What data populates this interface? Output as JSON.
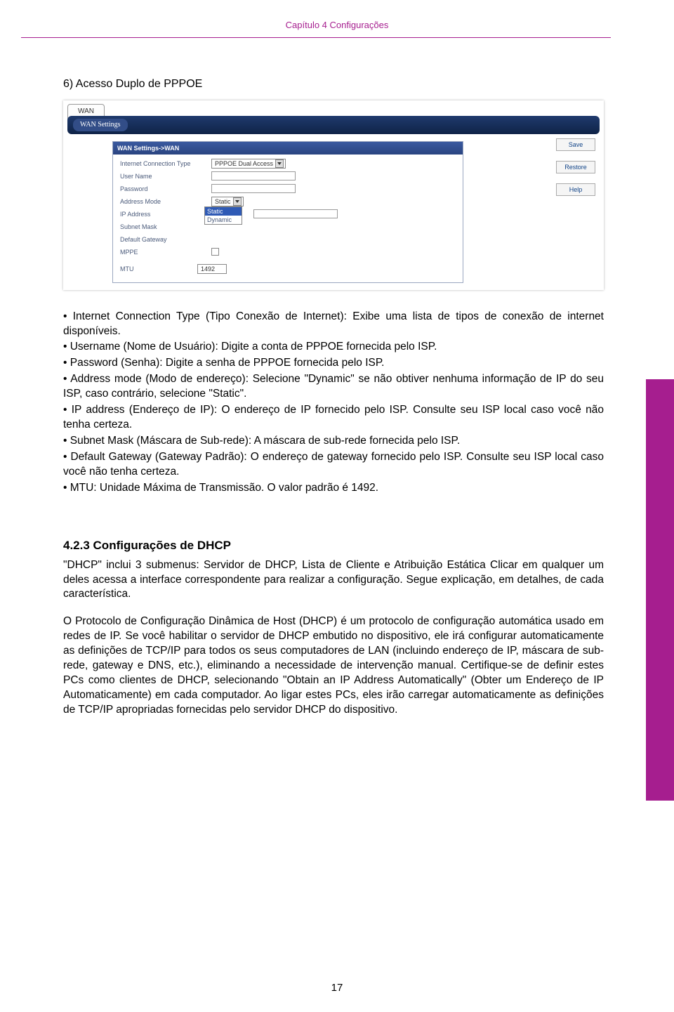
{
  "header": {
    "chapter": "Capítulo 4 Configurações"
  },
  "section": {
    "title": "6) Acesso Duplo de PPPOE"
  },
  "screenshot": {
    "tab": "WAN",
    "settings_btn": "WAN Settings",
    "panel_head": "WAN Settings->WAN",
    "side_buttons": [
      "Save",
      "Restore",
      "Help"
    ],
    "rows": {
      "conn_type_label": "Internet Connection Type",
      "conn_type_value": "PPPOE Dual Access",
      "user_name": "User Name",
      "password": "Password",
      "address_mode": "Address Mode",
      "address_mode_value": "Static",
      "ip_address": "IP Address",
      "subnet_mask": "Subnet Mask",
      "default_gateway": "Default Gateway",
      "mppe": "MPPE",
      "mtu": "MTU",
      "mtu_value": "1492"
    },
    "dropdown_options": {
      "opt1": "Static",
      "opt2": "Dynamic"
    }
  },
  "bullets": {
    "b1": "• Internet Connection Type (Tipo Conexão de Internet): Exibe uma lista de tipos de conexão de internet disponíveis.",
    "b2": "• Username (Nome de Usuário): Digite a conta de PPPOE fornecida pelo ISP.",
    "b3": "• Password (Senha): Digite a senha de PPPOE fornecida pelo ISP.",
    "b4": "• Address mode (Modo de endereço): Selecione \"Dynamic\" se não obtiver nenhuma informação de IP do seu ISP, caso contrário, selecione \"Static\".",
    "b5": "• IP address (Endereço de IP): O endereço de IP fornecido pelo ISP. Consulte seu ISP local caso você não tenha certeza.",
    "b6": "• Subnet Mask (Máscara de Sub-rede): A máscara de sub-rede fornecida pelo ISP.",
    "b7": "• Default Gateway (Gateway Padrão): O endereço de gateway fornecido pelo ISP. Consulte seu ISP local caso você não tenha certeza.",
    "b8": "• MTU: Unidade Máxima de Transmissão. O valor padrão é 1492."
  },
  "subsection": {
    "num_title": "4.2.3   Configurações de DHCP",
    "p1": "\"DHCP\" inclui 3 submenus: Servidor de DHCP, Lista de Cliente e Atribuição Estática Clicar em qualquer um deles acessa a interface correspondente para realizar a configuração. Segue explicação, em detalhes, de cada característica.",
    "p2": "O Protocolo de Configuração Dinâmica de Host (DHCP) é um protocolo de configuração automática usado em redes de IP. Se você habilitar o servidor de DHCP embutido no dispositivo, ele irá configurar automaticamente as definições de TCP/IP para todos os seus computadores de LAN (incluindo endereço de IP, máscara de sub-rede, gateway e DNS, etc.), eliminando a necessidade de intervenção manual. Certifique-se de definir estes PCs como clientes de DHCP, selecionando \"Obtain an IP Address Automatically\" (Obter um Endereço de IP Automaticamente) em cada computador. Ao ligar estes PCs, eles irão carregar automaticamente as definições de TCP/IP apropriadas fornecidas pelo servidor DHCP do dispositivo."
  },
  "page_number": "17"
}
